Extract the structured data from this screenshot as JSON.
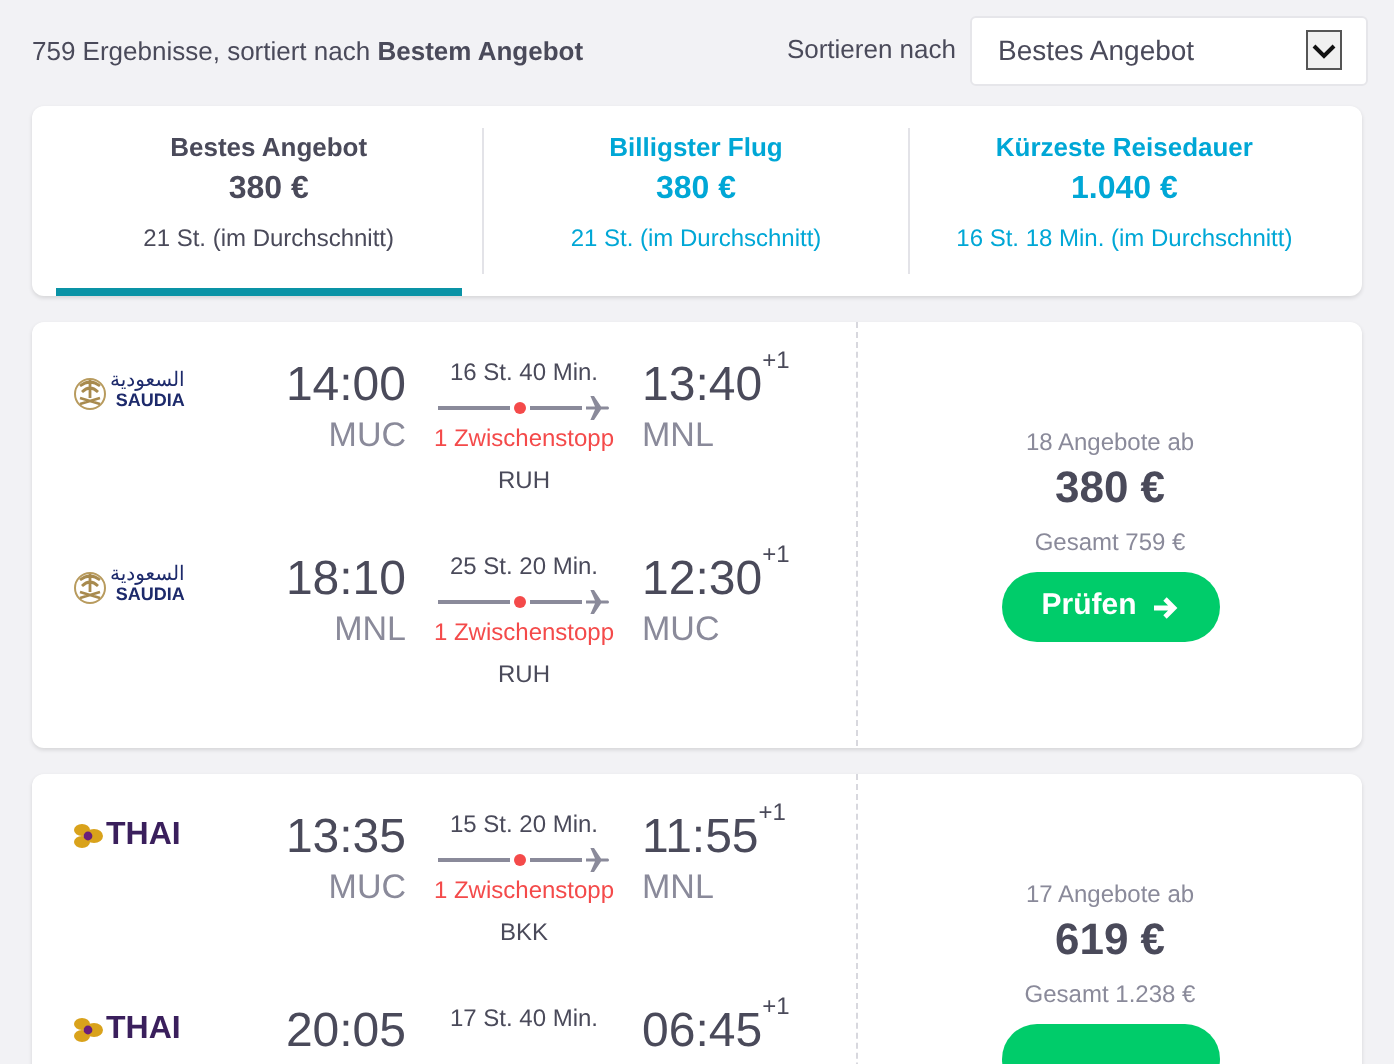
{
  "results_summary": "759 Ergebnisse, sortiert nach **Bestem Angebot**",
  "sort": {
    "label": "Sortieren nach",
    "value": "Bestes Angebot"
  },
  "tabs": [
    {
      "title": "Bestes Angebot",
      "price": "380 €",
      "duration": "21 St. (im Durchschnitt)",
      "selected": true
    },
    {
      "title": "Billigster Flug",
      "price": "380 €",
      "duration": "21 St. (im Durchschnitt)",
      "selected": false
    },
    {
      "title": "Kürzeste Reisedauer",
      "price": "1.040 €",
      "duration": "16 St. 18 Min. (im Durchschnitt)",
      "selected": false
    }
  ],
  "flights": [
    {
      "legs": [
        {
          "airline": {
            "kind": "saudia",
            "script": "السعودية",
            "name": "SAUDIA"
          },
          "dep_time": "14:00",
          "dep_airport": "MUC",
          "duration": "16 St. 40 Min.",
          "stops": "1 Zwischenstopp",
          "stop_airport": "RUH",
          "arr_time": "13:40",
          "arr_day_offset": "+1",
          "arr_airport": "MNL"
        },
        {
          "airline": {
            "kind": "saudia",
            "script": "السعودية",
            "name": "SAUDIA"
          },
          "dep_time": "18:10",
          "dep_airport": "MNL",
          "duration": "25 St. 20 Min.",
          "stops": "1 Zwischenstopp",
          "stop_airport": "RUH",
          "arr_time": "12:30",
          "arr_day_offset": "+1",
          "arr_airport": "MUC"
        }
      ],
      "offers": "18 Angebote ab",
      "price": "380 €",
      "total": "Gesamt 759 €",
      "button": "Prüfen"
    },
    {
      "legs": [
        {
          "airline": {
            "kind": "thai",
            "name": "THAI"
          },
          "dep_time": "13:35",
          "dep_airport": "MUC",
          "duration": "15 St. 20 Min.",
          "stops": "1 Zwischenstopp",
          "stop_airport": "BKK",
          "arr_time": "11:55",
          "arr_day_offset": "+1",
          "arr_airport": "MNL"
        },
        {
          "airline": {
            "kind": "thai",
            "name": "THAI"
          },
          "dep_time": "20:05",
          "duration": "17 St. 40 Min.",
          "arr_time": "06:45",
          "arr_day_offset": "+1"
        }
      ],
      "offers": "17 Angebote ab",
      "price": "619 €",
      "total": "Gesamt 1.238 €"
    }
  ]
}
